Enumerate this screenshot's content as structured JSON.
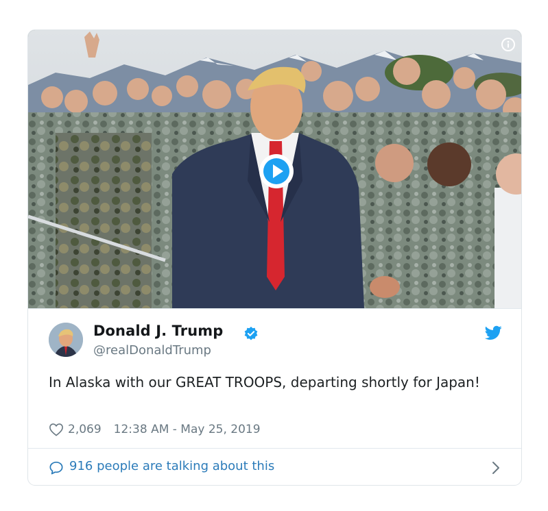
{
  "tweet": {
    "author_name": "Donald J. Trump",
    "author_handle": "@realDonaldTrump",
    "text": "In Alaska with our GREAT TROOPS, departing shortly for Japan!",
    "like_count": "2,069",
    "timestamp": "12:38 AM - May 25, 2019",
    "talking_text": "916 people are talking about this"
  },
  "icons": {
    "info": "info-icon",
    "play": "play-icon",
    "verified": "verified-badge-icon",
    "twitter": "twitter-bird-icon",
    "heart": "heart-icon",
    "reply": "speech-bubble-icon",
    "chevron": "chevron-right-icon"
  },
  "colors": {
    "accent": "#1da1f2",
    "link": "#2b7bb9",
    "text": "#1c2022",
    "muted": "#697882",
    "border": "#e1e8ed"
  }
}
